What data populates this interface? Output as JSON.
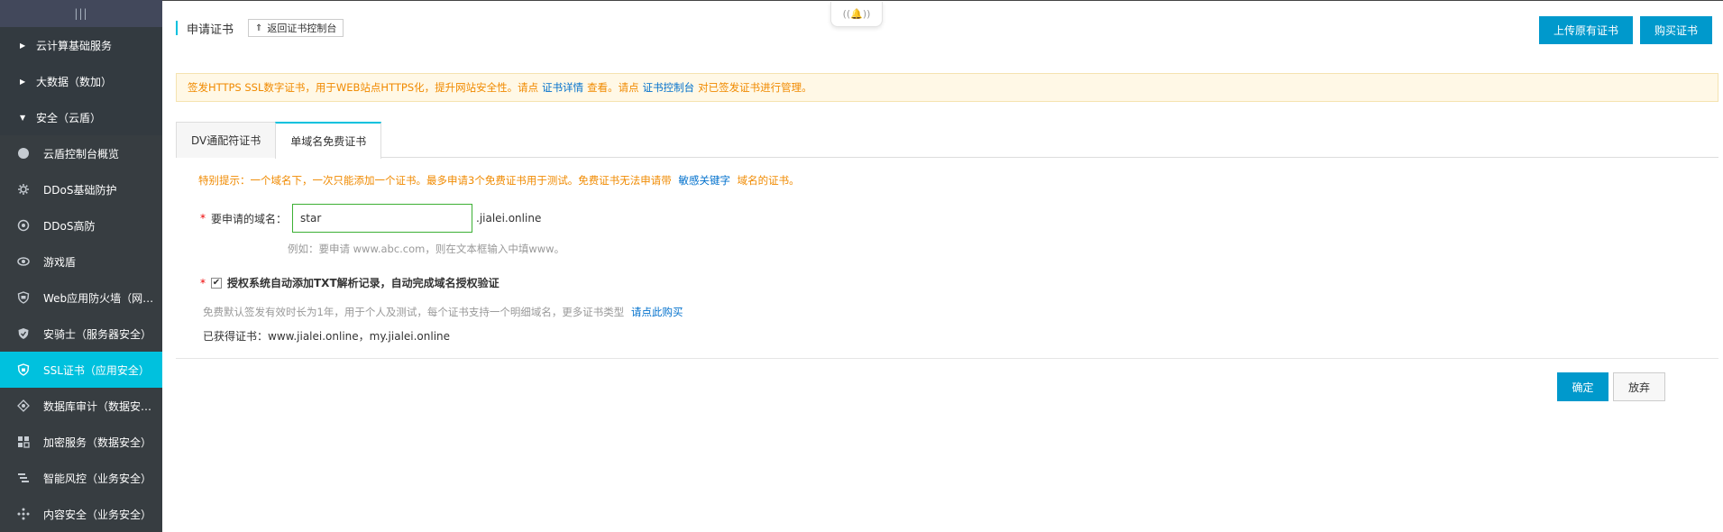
{
  "sidebar": {
    "top_handle": "|||",
    "groups": [
      {
        "label": "云计算基础服务",
        "expanded": false
      },
      {
        "label": "大数据（数加）",
        "expanded": false
      },
      {
        "label": "安全（云盾）",
        "expanded": true
      }
    ],
    "items": [
      {
        "label": "云盾控制台概览",
        "icon": "circle-icon",
        "active": false
      },
      {
        "label": "DDoS基础防护",
        "icon": "gear-icon",
        "active": false
      },
      {
        "label": "DDoS高防",
        "icon": "shield-gear-icon",
        "active": false
      },
      {
        "label": "游戏盾",
        "icon": "eye-icon",
        "active": false
      },
      {
        "label": "Web应用防火墙（网…",
        "icon": "firewall-shield-icon",
        "active": false
      },
      {
        "label": "安骑士（服务器安全）",
        "icon": "knight-shield-icon",
        "active": false
      },
      {
        "label": "SSL证书（应用安全）",
        "icon": "ssl-shield-icon",
        "active": true
      },
      {
        "label": "数据库审计（数据安…",
        "icon": "database-audit-icon",
        "active": false
      },
      {
        "label": "加密服务（数据安全）",
        "icon": "encryption-icon",
        "active": false
      },
      {
        "label": "智能风控（业务安全）",
        "icon": "risk-control-icon",
        "active": false
      },
      {
        "label": "内容安全（业务安全）",
        "icon": "content-security-icon",
        "active": false
      }
    ]
  },
  "notify": {
    "icon": "bell-icon",
    "text": "((🔔))"
  },
  "header": {
    "title": "申请证书",
    "back_label": "返回证书控制台",
    "upload_label": "上传原有证书",
    "buy_label": "购买证书"
  },
  "notice": {
    "text_before": "签发HTTPS SSL数字证书，用于WEB站点HTTPS化，提升网站安全性。请点",
    "link1": "证书详情",
    "text_middle": "查看。请点",
    "link2": "证书控制台",
    "text_after": "对已签发证书进行管理。"
  },
  "tabs": [
    {
      "label": "DV通配符证书",
      "active": false
    },
    {
      "label": "单域名免费证书",
      "active": true
    }
  ],
  "form": {
    "tip_before": "特别提示：一个域名下，一次只能添加一个证书。最多申请3个免费证书用于测试。免费证书无法申请带",
    "tip_link": "敏感关键字",
    "tip_after": "域名的证书。",
    "required_mark": "*",
    "domain_label": "要申请的域名：",
    "domain_value": "star",
    "domain_suffix": ".jialei.online",
    "example": "例如：要申请 www.abc.com，则在文本框输入中填www。",
    "auth_checked": true,
    "auth_label": "授权系统自动添加TXT解析记录，自动完成域名授权验证",
    "free_desc": "免费默认签发有效时长为1年，用于个人及测试，每个证书支持一个明细域名，更多证书类型",
    "free_link": "请点此购买",
    "obtained": "已获得证书：www.jialei.online，my.jialei.online"
  },
  "actions": {
    "confirm_label": "确定",
    "cancel_label": "放弃"
  }
}
